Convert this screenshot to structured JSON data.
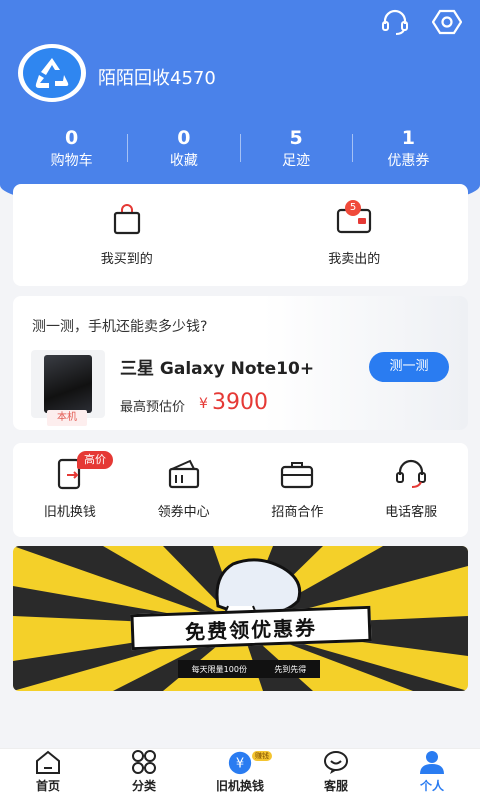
{
  "profile": {
    "username": "陌陌回收4570"
  },
  "stats": [
    {
      "num": "0",
      "label": "购物车"
    },
    {
      "num": "0",
      "label": "收藏"
    },
    {
      "num": "5",
      "label": "足迹"
    },
    {
      "num": "1",
      "label": "优惠券"
    }
  ],
  "orders": {
    "bought": "我买到的",
    "sold": "我卖出的",
    "sold_badge": "5"
  },
  "estimate": {
    "question": "测一测，手机还能卖多少钱?",
    "tag": "本机",
    "model": "三星 Galaxy Note10+",
    "label": "最高预估价",
    "currency": "¥",
    "price": "3900",
    "button": "测一测"
  },
  "services": [
    {
      "label": "旧机换钱",
      "badge": "高价"
    },
    {
      "label": "领券中心"
    },
    {
      "label": "招商合作"
    },
    {
      "label": "电话客服"
    }
  ],
  "banner": {
    "title": "免费领优惠券",
    "sub1": "每天限量100份",
    "sub2": "先到先得"
  },
  "tabs": [
    {
      "label": "首页"
    },
    {
      "label": "分类"
    },
    {
      "label": "旧机换钱",
      "badge": "赚钱"
    },
    {
      "label": "客服"
    },
    {
      "label": "个人"
    }
  ],
  "colors": {
    "primary": "#4a82ea",
    "accent": "#2a7cf1",
    "price": "#e53935"
  }
}
